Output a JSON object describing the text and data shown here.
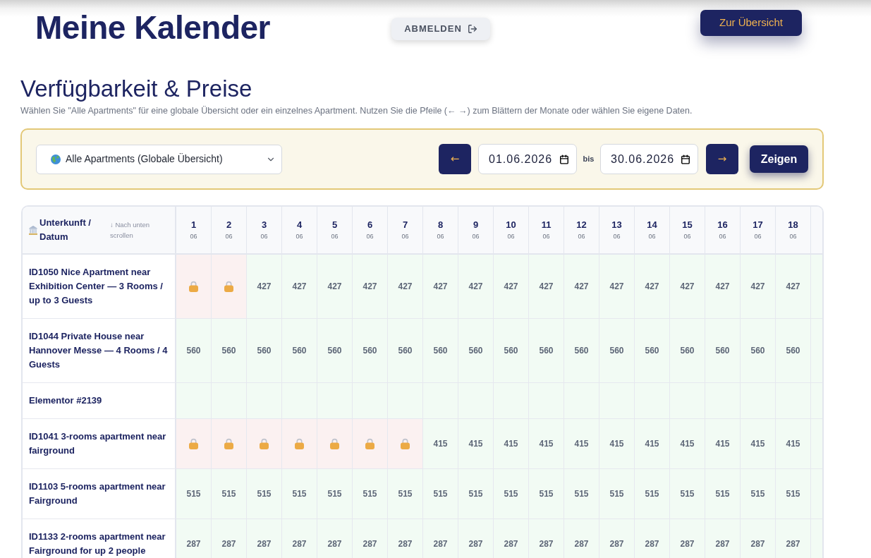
{
  "header": {
    "title": "Meine Kalender",
    "logout_button": "ABMELDEN",
    "overview_button": "Zur Übersicht"
  },
  "section": {
    "title": "Verfügbarkeit & Preise",
    "description": "Wählen Sie \"Alle Apartments\" für eine globale Übersicht oder ein einzelnes Apartment. Nutzen Sie die Pfeile (← →) zum Blättern der Monate oder wählen Sie eigene Daten."
  },
  "filter": {
    "apartment_select": "Alle Apartments (Globale Übersicht)",
    "prev_button": "←",
    "start_date": "01.06.2026",
    "separator": "bis",
    "end_date": "30.06.2026",
    "next_button": "→",
    "show_button": "Zeigen"
  },
  "table": {
    "corner": {
      "label": "Unterkunft / Datum",
      "hint": "↓ Nach unten scrollen"
    },
    "days": [
      {
        "day": "1",
        "month": "06"
      },
      {
        "day": "2",
        "month": "06"
      },
      {
        "day": "3",
        "month": "06"
      },
      {
        "day": "4",
        "month": "06"
      },
      {
        "day": "5",
        "month": "06"
      },
      {
        "day": "6",
        "month": "06"
      },
      {
        "day": "7",
        "month": "06"
      },
      {
        "day": "8",
        "month": "06"
      },
      {
        "day": "9",
        "month": "06"
      },
      {
        "day": "10",
        "month": "06"
      },
      {
        "day": "11",
        "month": "06"
      },
      {
        "day": "12",
        "month": "06"
      },
      {
        "day": "13",
        "month": "06"
      },
      {
        "day": "14",
        "month": "06"
      },
      {
        "day": "15",
        "month": "06"
      },
      {
        "day": "16",
        "month": "06"
      },
      {
        "day": "17",
        "month": "06"
      },
      {
        "day": "18",
        "month": "06"
      }
    ],
    "rows": [
      {
        "name": "ID1050 Nice Apartment near Exhibition Center — 3 Rooms / up to 3 Guests",
        "cells": [
          {
            "kind": "locked"
          },
          {
            "kind": "locked"
          },
          {
            "kind": "price",
            "price": "427"
          },
          {
            "kind": "price",
            "price": "427"
          },
          {
            "kind": "price",
            "price": "427"
          },
          {
            "kind": "price",
            "price": "427"
          },
          {
            "kind": "price",
            "price": "427"
          },
          {
            "kind": "price",
            "price": "427"
          },
          {
            "kind": "price",
            "price": "427"
          },
          {
            "kind": "price",
            "price": "427"
          },
          {
            "kind": "price",
            "price": "427"
          },
          {
            "kind": "price",
            "price": "427"
          },
          {
            "kind": "price",
            "price": "427"
          },
          {
            "kind": "price",
            "price": "427"
          },
          {
            "kind": "price",
            "price": "427"
          },
          {
            "kind": "price",
            "price": "427"
          },
          {
            "kind": "price",
            "price": "427"
          },
          {
            "kind": "price",
            "price": "427"
          },
          {
            "kind": "empty"
          }
        ]
      },
      {
        "name": "ID1044 Private House near Hannover Messe — 4 Rooms / 4 Guests",
        "cells": [
          {
            "kind": "price",
            "price": "560"
          },
          {
            "kind": "price",
            "price": "560"
          },
          {
            "kind": "price",
            "price": "560"
          },
          {
            "kind": "price",
            "price": "560"
          },
          {
            "kind": "price",
            "price": "560"
          },
          {
            "kind": "price",
            "price": "560"
          },
          {
            "kind": "price",
            "price": "560"
          },
          {
            "kind": "price",
            "price": "560"
          },
          {
            "kind": "price",
            "price": "560"
          },
          {
            "kind": "price",
            "price": "560"
          },
          {
            "kind": "price",
            "price": "560"
          },
          {
            "kind": "price",
            "price": "560"
          },
          {
            "kind": "price",
            "price": "560"
          },
          {
            "kind": "price",
            "price": "560"
          },
          {
            "kind": "price",
            "price": "560"
          },
          {
            "kind": "price",
            "price": "560"
          },
          {
            "kind": "price",
            "price": "560"
          },
          {
            "kind": "price",
            "price": "560"
          },
          {
            "kind": "empty"
          }
        ]
      },
      {
        "name": "Elementor #2139",
        "cells": [
          {
            "kind": "empty"
          },
          {
            "kind": "empty"
          },
          {
            "kind": "empty"
          },
          {
            "kind": "empty"
          },
          {
            "kind": "empty"
          },
          {
            "kind": "empty"
          },
          {
            "kind": "empty"
          },
          {
            "kind": "empty"
          },
          {
            "kind": "empty"
          },
          {
            "kind": "empty"
          },
          {
            "kind": "empty"
          },
          {
            "kind": "empty"
          },
          {
            "kind": "empty"
          },
          {
            "kind": "empty"
          },
          {
            "kind": "empty"
          },
          {
            "kind": "empty"
          },
          {
            "kind": "empty"
          },
          {
            "kind": "empty"
          },
          {
            "kind": "empty"
          }
        ]
      },
      {
        "name": "ID1041 3-rooms apartment near fairground",
        "cells": [
          {
            "kind": "locked"
          },
          {
            "kind": "locked"
          },
          {
            "kind": "locked"
          },
          {
            "kind": "locked"
          },
          {
            "kind": "locked"
          },
          {
            "kind": "locked"
          },
          {
            "kind": "locked"
          },
          {
            "kind": "price",
            "price": "415"
          },
          {
            "kind": "price",
            "price": "415"
          },
          {
            "kind": "price",
            "price": "415"
          },
          {
            "kind": "price",
            "price": "415"
          },
          {
            "kind": "price",
            "price": "415"
          },
          {
            "kind": "price",
            "price": "415"
          },
          {
            "kind": "price",
            "price": "415"
          },
          {
            "kind": "price",
            "price": "415"
          },
          {
            "kind": "price",
            "price": "415"
          },
          {
            "kind": "price",
            "price": "415"
          },
          {
            "kind": "price",
            "price": "415"
          },
          {
            "kind": "empty"
          }
        ]
      },
      {
        "name": "ID1103 5-rooms apartment near Fairground",
        "cells": [
          {
            "kind": "price",
            "price": "515"
          },
          {
            "kind": "price",
            "price": "515"
          },
          {
            "kind": "price",
            "price": "515"
          },
          {
            "kind": "price",
            "price": "515"
          },
          {
            "kind": "price",
            "price": "515"
          },
          {
            "kind": "price",
            "price": "515"
          },
          {
            "kind": "price",
            "price": "515"
          },
          {
            "kind": "price",
            "price": "515"
          },
          {
            "kind": "price",
            "price": "515"
          },
          {
            "kind": "price",
            "price": "515"
          },
          {
            "kind": "price",
            "price": "515"
          },
          {
            "kind": "price",
            "price": "515"
          },
          {
            "kind": "price",
            "price": "515"
          },
          {
            "kind": "price",
            "price": "515"
          },
          {
            "kind": "price",
            "price": "515"
          },
          {
            "kind": "price",
            "price": "515"
          },
          {
            "kind": "price",
            "price": "515"
          },
          {
            "kind": "price",
            "price": "515"
          },
          {
            "kind": "empty"
          }
        ]
      },
      {
        "name": "ID1133 2-rooms apartment near Fairground for up 2 people",
        "cells": [
          {
            "kind": "price",
            "price": "287"
          },
          {
            "kind": "price",
            "price": "287"
          },
          {
            "kind": "price",
            "price": "287"
          },
          {
            "kind": "price",
            "price": "287"
          },
          {
            "kind": "price",
            "price": "287"
          },
          {
            "kind": "price",
            "price": "287"
          },
          {
            "kind": "price",
            "price": "287"
          },
          {
            "kind": "price",
            "price": "287"
          },
          {
            "kind": "price",
            "price": "287"
          },
          {
            "kind": "price",
            "price": "287"
          },
          {
            "kind": "price",
            "price": "287"
          },
          {
            "kind": "price",
            "price": "287"
          },
          {
            "kind": "price",
            "price": "287"
          },
          {
            "kind": "price",
            "price": "287"
          },
          {
            "kind": "price",
            "price": "287"
          },
          {
            "kind": "price",
            "price": "287"
          },
          {
            "kind": "price",
            "price": "287"
          },
          {
            "kind": "price",
            "price": "287"
          },
          {
            "kind": "empty"
          }
        ]
      }
    ]
  }
}
